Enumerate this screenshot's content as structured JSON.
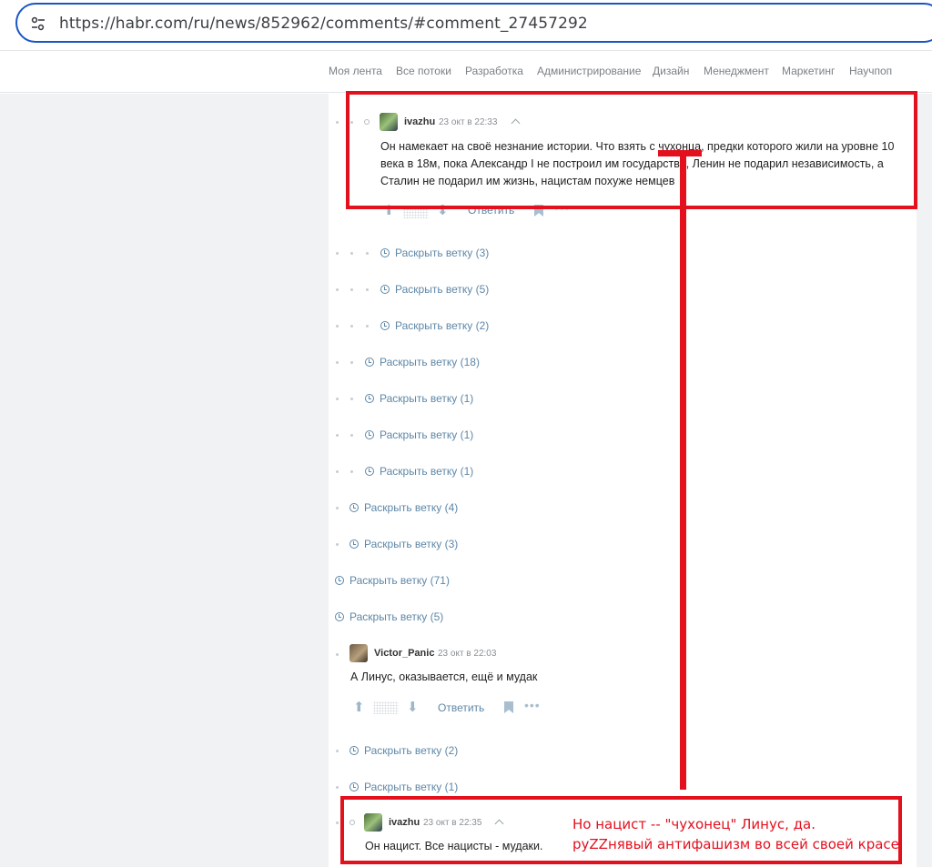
{
  "browser": {
    "url": "https://habr.com/ru/news/852962/comments/#comment_27457292"
  },
  "nav": {
    "items": [
      "Моя лента",
      "Все потоки",
      "Разработка",
      "Администрирование",
      "Дизайн",
      "Менеджмент",
      "Маркетинг",
      "Научпоп"
    ]
  },
  "comment_top": {
    "username": "ivazhu",
    "time": "23 окт в 22:33",
    "text_line1": "Он намекает на своё незнание истории. Что взять с чухонца, предки которого жили на уровне 10",
    "text_line2": "века в 18м, пока Александр I не построил им государство, Ленин не подарил независимость, а",
    "text_line3": "Сталин не подарил им жизнь, нацистам похуже немцев",
    "reply_label": "Ответить"
  },
  "expanders": [
    "Раскрыть ветку (3)",
    "Раскрыть ветку (5)",
    "Раскрыть ветку (2)",
    "Раскрыть ветку (18)",
    "Раскрыть ветку (1)",
    "Раскрыть ветку (1)",
    "Раскрыть ветку (1)",
    "Раскрыть ветку (4)",
    "Раскрыть ветку (3)",
    "Раскрыть ветку (71)",
    "Раскрыть ветку (5)",
    "Раскрыть ветку (2)",
    "Раскрыть ветку (1)"
  ],
  "comment_victor": {
    "username": "Victor_Panic",
    "time": "23 окт в 22:03",
    "text": "А Линус, оказывается, ещё и мудак",
    "reply_label": "Ответить"
  },
  "comment_bottom": {
    "username": "ivazhu",
    "time": "23 окт в 22:35",
    "text": "Он нацист. Все нацисты - мудаки."
  },
  "annotation": {
    "line1": "Но нацист -- \"чухонец\" Линус, да.",
    "line2": "руZZнявый антифашизм во всей своей красе.",
    "color": "#e3101e"
  }
}
